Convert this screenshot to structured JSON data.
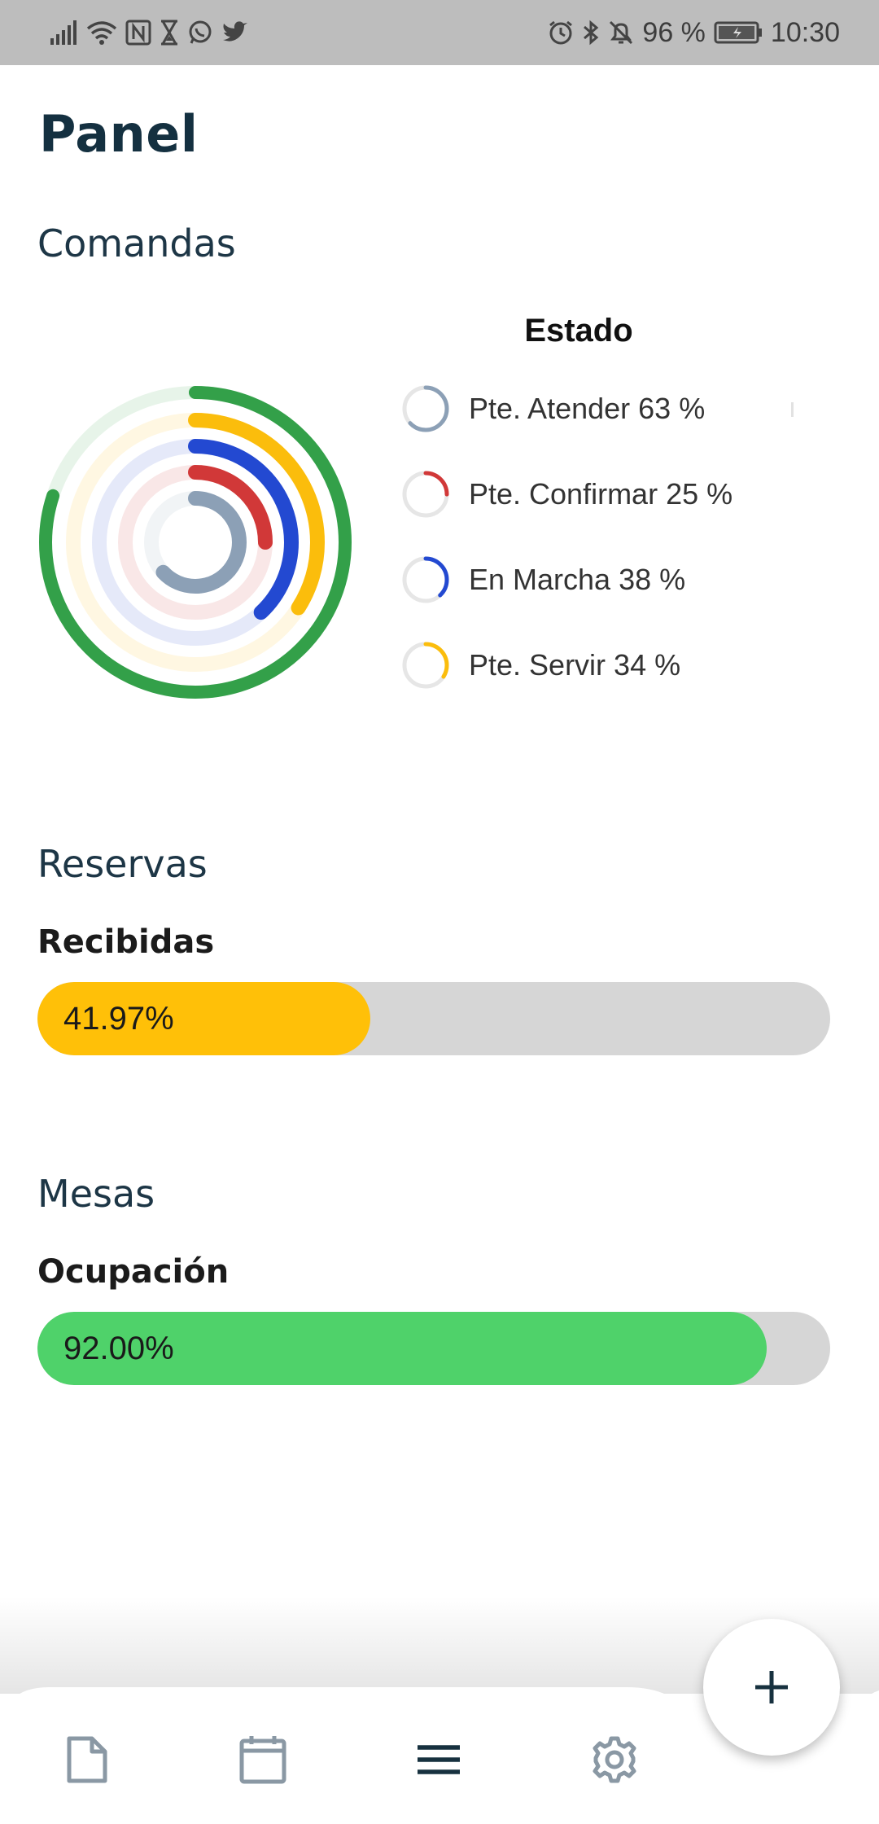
{
  "status_bar": {
    "battery_percent": "96 %",
    "time": "10:30",
    "left_icons": [
      "signal-icon",
      "wifi-icon",
      "nfc-icon",
      "hourglass-icon",
      "whatsapp-icon",
      "twitter-icon"
    ],
    "right_icons": [
      "alarm-icon",
      "bluetooth-icon",
      "bell-off-icon",
      "battery-icon"
    ]
  },
  "page_title": "Panel",
  "comandas": {
    "section_title": "Comandas",
    "legend_title": "Estado",
    "items": [
      {
        "label": "Pte. Atender 63 %",
        "percent": 63,
        "color": "#8ca0b6"
      },
      {
        "label": "Pte. Confirmar 25 %",
        "percent": 25,
        "color": "#d13838"
      },
      {
        "label": "En Marcha 38 %",
        "percent": 38,
        "color": "#2349d1"
      },
      {
        "label": "Pte. Servir 34 %",
        "percent": 34,
        "color": "#fbbd0c"
      }
    ],
    "outer_ring": {
      "percent": 80,
      "color": "#33a049"
    }
  },
  "reservas": {
    "section_title": "Reservas",
    "subtitle": "Recibidas",
    "value_text": "41.97%",
    "fraction": 0.4197,
    "color": "#ffc008"
  },
  "mesas": {
    "section_title": "Mesas",
    "subtitle": "Ocupación",
    "value_text": "92.00%",
    "fraction": 0.92,
    "color": "#4fd26a"
  },
  "bottom_nav": {
    "items": [
      "document-icon",
      "calendar-icon",
      "menu-icon",
      "settings-icon"
    ],
    "fab_icon": "plus-icon"
  }
}
